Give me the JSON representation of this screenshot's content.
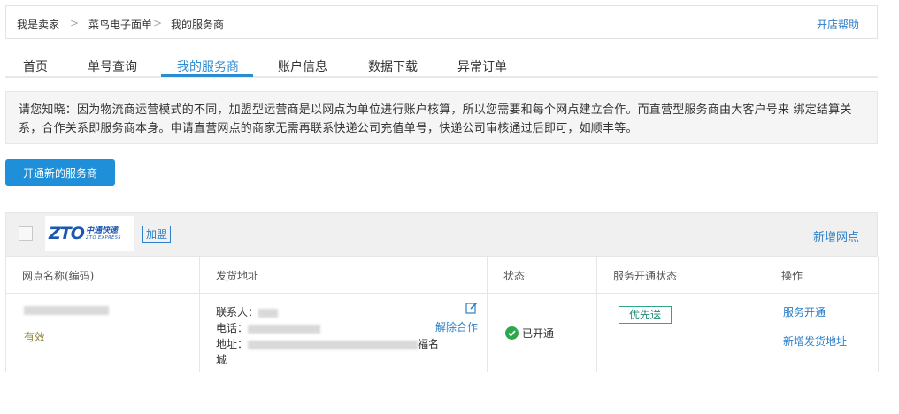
{
  "breadcrumb": {
    "items": [
      "我是卖家",
      "菜鸟电子面单",
      "我的服务商"
    ],
    "separator": ">"
  },
  "help_link": "开店帮助",
  "tabs": [
    {
      "label": "首页",
      "active": false
    },
    {
      "label": "单号查询",
      "active": false
    },
    {
      "label": "我的服务商",
      "active": true
    },
    {
      "label": "账户信息",
      "active": false
    },
    {
      "label": "数据下载",
      "active": false
    },
    {
      "label": "异常订单",
      "active": false
    }
  ],
  "notice": "请您知晓：因为物流商运营模式的不同，加盟型运营商是以网点为单位进行账户核算，所以您需要和每个网点建立合作。而直营型服务商由大客户号来 绑定结算关系，合作关系即服务商本身。申请直营网点的商家无需再联系快递公司充值单号，快递公司审核通过后即可，如顺丰等。",
  "open_new_button": "开通新的服务商",
  "provider": {
    "logo_text": "ZTO",
    "logo_cn": "中通快递",
    "logo_en": "ZTO EXPRESS",
    "type_badge": "加盟",
    "add_node_link": "新增网点"
  },
  "table": {
    "headers": [
      "网点名称(编码)",
      "发货地址",
      "状态",
      "服务开通状态",
      "操作"
    ],
    "rows": [
      {
        "node_status": "有效",
        "contact_label": "联系人：",
        "phone_label": "电话：",
        "address_label": "地址：",
        "address_tail": "福名",
        "address_end": "城",
        "unbind": "解除合作",
        "status": "已开通",
        "service_badge": "优先送",
        "actions": [
          "服务开通",
          "新增发货地址"
        ]
      }
    ]
  },
  "colors": {
    "accent": "#2d8bd4",
    "link": "#2d7fc7",
    "ok": "#2ba84a",
    "badge_border": "#31a58a"
  },
  "icons": {
    "edit": "edit-icon",
    "status_ok": "check-circle-icon"
  }
}
